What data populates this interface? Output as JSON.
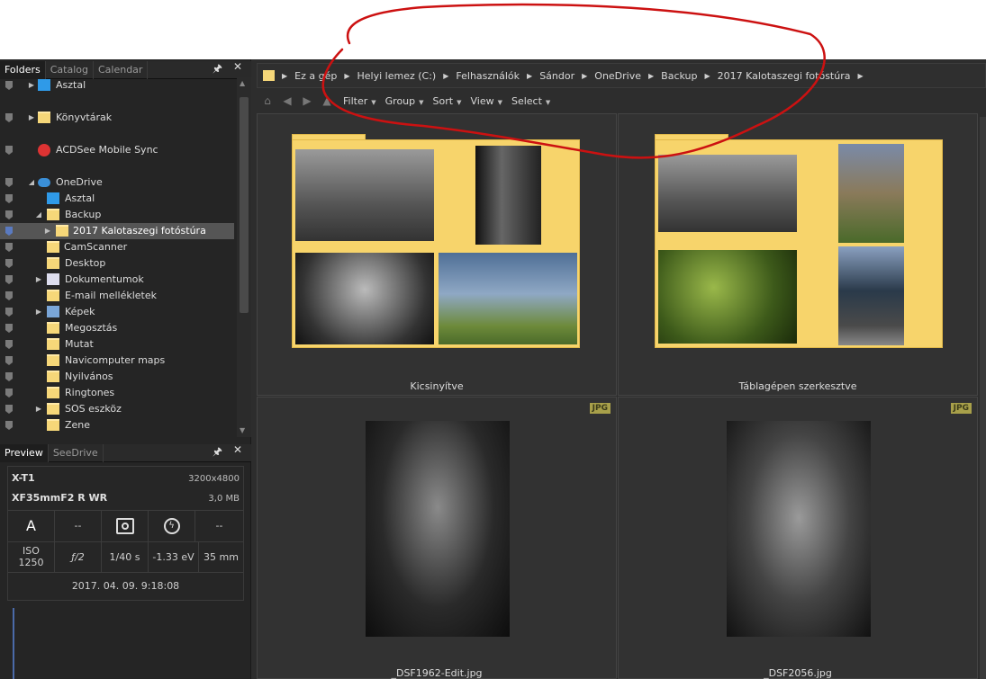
{
  "folders_panel": {
    "tabs": [
      "Folders",
      "Catalog",
      "Calendar"
    ],
    "pin": "🖈",
    "close": "✕",
    "items": [
      {
        "label": "Asztal"
      },
      {
        "label": "Könyvtárak"
      },
      {
        "label": "ACDSee Mobile Sync"
      },
      {
        "label": "OneDrive"
      },
      {
        "label": "Asztal"
      },
      {
        "label": "Backup"
      },
      {
        "label": "2017 Kalotaszegi fotóstúra"
      },
      {
        "label": "CamScanner"
      },
      {
        "label": "Desktop"
      },
      {
        "label": "Dokumentumok"
      },
      {
        "label": "E-mail mellékletek"
      },
      {
        "label": "Képek"
      },
      {
        "label": "Megosztás"
      },
      {
        "label": "Mutat"
      },
      {
        "label": "Navicomputer maps"
      },
      {
        "label": "Nyilvános"
      },
      {
        "label": "Ringtones"
      },
      {
        "label": "SOS eszköz"
      },
      {
        "label": "Zene"
      }
    ]
  },
  "preview_panel": {
    "tabs": [
      "Preview",
      "SeeDrive"
    ],
    "camera": "X-T1",
    "resolution": "3200x4800",
    "lens": "XF35mmF2 R WR",
    "filesize": "3,0 MB",
    "mode": "A",
    "dash1": "--",
    "dash2": "--",
    "iso_label": "ISO",
    "iso_value": "1250",
    "aperture": "ƒ/2",
    "shutter": "1/40 s",
    "exposure": "-1.33 eV",
    "focal": "35 mm",
    "datetime": "2017. 04. 09. 9:18:08"
  },
  "breadcrumb": [
    "Ez a gép",
    "Helyi lemez (C:)",
    "Felhasználók",
    "Sándor",
    "OneDrive",
    "Backup",
    "2017 Kalotaszegi fotóstúra"
  ],
  "toolbar": {
    "filter": "Filter",
    "group": "Group",
    "sort": "Sort",
    "view": "View",
    "select": "Select"
  },
  "tiles": [
    {
      "label": "Kicsinyítve",
      "type": "folder"
    },
    {
      "label": "Táblagépen szerkesztve",
      "type": "folder"
    },
    {
      "label": "_DSF1962-Edit.jpg",
      "badge": "JPG"
    },
    {
      "label": "_DSF2056.jpg",
      "badge": "JPG"
    }
  ],
  "colors": {
    "accent_folder": "#f7d46b",
    "annotation": "#cc1111",
    "jpg_badge": "#a8a04a"
  }
}
